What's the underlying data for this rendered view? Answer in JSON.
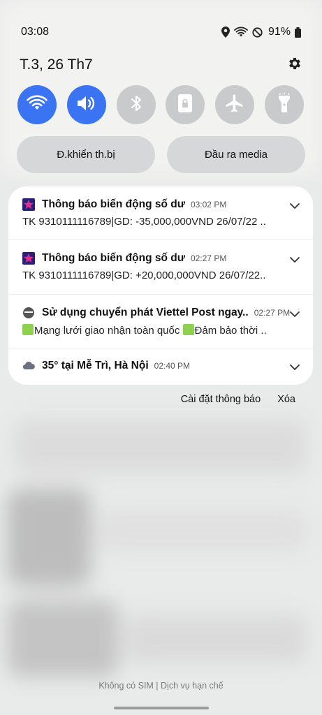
{
  "status_bar": {
    "time": "03:08",
    "battery": "91%",
    "icons": [
      "location-icon",
      "wifi-icon",
      "do-not-disturb-icon",
      "battery-icon"
    ]
  },
  "header": {
    "date": "T.3, 26 Th7",
    "settings_icon": "gear-icon"
  },
  "quick_toggles": [
    {
      "name": "wifi",
      "icon": "wifi-icon",
      "active": true
    },
    {
      "name": "sound",
      "icon": "speaker-icon",
      "active": true
    },
    {
      "name": "bluetooth",
      "icon": "bluetooth-icon",
      "active": false
    },
    {
      "name": "rotation-lock",
      "icon": "lock-icon",
      "active": false
    },
    {
      "name": "airplane-mode",
      "icon": "airplane-icon",
      "active": false
    },
    {
      "name": "flashlight",
      "icon": "flashlight-icon",
      "active": false
    }
  ],
  "pills": {
    "device_control": "Đ.khiển th.bị",
    "media_output": "Đầu ra media"
  },
  "notifications": [
    {
      "title": "Thông báo biến động số dư",
      "time": "03:02 PM",
      "body": "TK 9310111116789|GD: -35,000,000VND 26/07/22 .."
    },
    {
      "title": "Thông báo biến động số dư",
      "time": "02:27 PM",
      "body": "TK 9310111116789|GD: +20,000,000VND 26/07/22.."
    },
    {
      "title": "Sử dụng chuyển phát Viettel Post ngay..",
      "time": "02:27 PM",
      "body_part1": "Mạng lưới giao nhận toàn quốc ",
      "body_part2": "Đảm bảo thời .."
    },
    {
      "title": "35° tại Mễ Trì, Hà Nội",
      "time": "02:40 PM"
    }
  ],
  "notification_actions": {
    "settings": "Cài đặt thông báo",
    "clear": "Xóa"
  },
  "footer": {
    "sim_status": "Không có SIM | Dịch vụ hạn chế"
  },
  "colors": {
    "accent": "#3a74f3",
    "toggle_off": "#c9cacb",
    "card": "#ffffff"
  }
}
